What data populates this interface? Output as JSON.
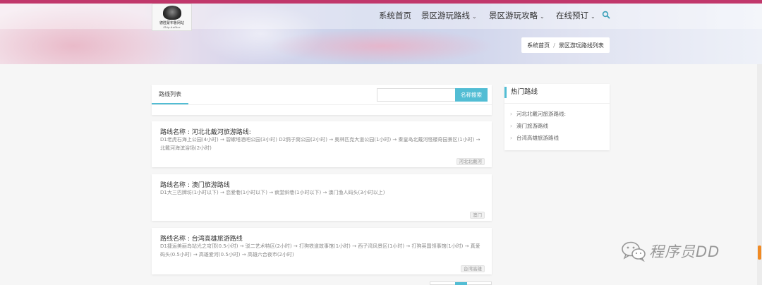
{
  "colors": {
    "top_bar": "#c1376b",
    "accent": "#52bdd4",
    "watermark_scroll": "#f08a24"
  },
  "logo": {
    "text": "德胜蒙布鲁网站",
    "sub": "Ship Author"
  },
  "nav": {
    "items": [
      {
        "label": "系统首页",
        "has_caret": false
      },
      {
        "label": "景区游玩路线",
        "has_caret": true
      },
      {
        "label": "景区游玩攻略",
        "has_caret": true
      },
      {
        "label": "在线预订",
        "has_caret": true
      }
    ],
    "search_icon": "search-icon"
  },
  "breadcrumb": {
    "home": "系统首页",
    "separator": "/",
    "current": "景区游玩路线列表"
  },
  "list_panel": {
    "tab_label": "路线列表",
    "search_placeholder": "",
    "search_button": "名称搜索"
  },
  "routes": [
    {
      "title": "路线名称 : 河北北戴河旅游路线:",
      "desc": "D1老虎石海上公园(4小时) → 碧螺塔酒吧公园(3小时) D2鸽子窝公园(2小时) → 奥林匹克大道公园(1小时) → 秦皇岛北戴河怪楼奇园景区(1小时) → 北戴河海滨浴场(2小时)",
      "tag": "河北北戴河"
    },
    {
      "title": "路线名称 : 澳门旅游路线",
      "desc": "D1大三巴牌坊(1小时以下) → 恋爱巷(1小时以下) → 疯堂斜巷(1小时以下) → 澳门渔人码头(3小时以上)",
      "tag": "澳门"
    },
    {
      "title": "路线名称 : 台湾高雄旅游路线",
      "desc": "D1捷运美丽岛站光之穹顶(0.5小时) → 驳二艺术特区(2小时) → 打狗铁道故事馆(1小时) → 西子湾风景区(1小时) → 打狗英国领事馆(1小时) → 真爱码头(0.5小时) → 高雄爱河(0.5小时) → 高雄六合夜市(2小时)",
      "tag": "台湾高雄"
    }
  ],
  "hot": {
    "title": "热门路线",
    "items": [
      "河北北戴河旅游路线:",
      "澳门旅游路线",
      "台湾高雄旅游路线"
    ]
  },
  "watermark": {
    "text": "程序员DD",
    "icon": "wechat-icon"
  }
}
